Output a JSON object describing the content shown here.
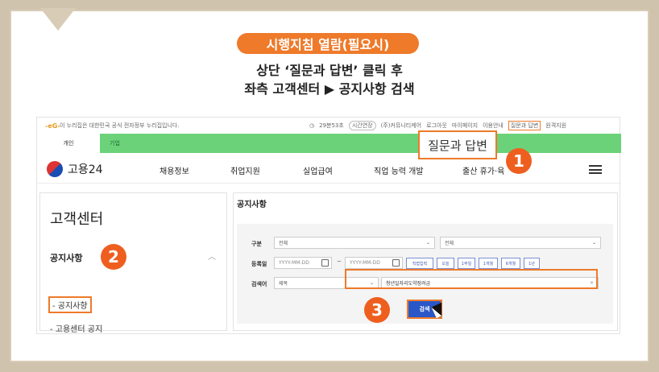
{
  "header": {
    "pill": "시행지침 열람(필요시)",
    "line1": "상단 ‘질문과 답변’ 클릭 후",
    "line2": "좌측 고객센터 ▶ 공지사항 검색"
  },
  "utility": {
    "logo": "-eG-",
    "gov_notice": "이 누리집은 대한민국 공식 전자정부 누리집입니다.",
    "timer": "29분53초",
    "extend": "시간연장",
    "links": [
      "(주)커뮤니티케어",
      "로그아웃",
      "마이페이지",
      "이용안내"
    ],
    "qa": "질문과 답변",
    "remote": "원격지원"
  },
  "tabs": {
    "personal": "개인",
    "company": "기업"
  },
  "nav": {
    "brand": "고용24",
    "items": [
      "채용정보",
      "취업지원",
      "실업급여",
      "직업 능력 개발",
      "출산 휴가·육"
    ]
  },
  "callout": {
    "qa": "질문과 답변",
    "badge1": "1",
    "badge2": "2",
    "badge3": "3"
  },
  "sidebar": {
    "title": "고객센터",
    "section": "공지사항",
    "items": [
      "- 공지사항",
      "- 고용센터 공지"
    ]
  },
  "main": {
    "title": "공지사항",
    "labels": {
      "category": "구분",
      "date": "등록일",
      "search": "검색어"
    },
    "category_sel1": "전체",
    "category_sel2": "전체",
    "date_from": "YYYY-MM-DD",
    "date_sep": "~",
    "date_to": "YYYY-MM-DD",
    "chips": [
      "직접입력",
      "오늘",
      "1주일",
      "1개월",
      "6개월",
      "1년"
    ],
    "search_sel": "제목",
    "keyword": "청년일자리도약장려금",
    "search_btn": "검색"
  },
  "colors": {
    "accent": "#ee7a2a",
    "green": "#6bd27a",
    "blue": "#2a57c8"
  }
}
